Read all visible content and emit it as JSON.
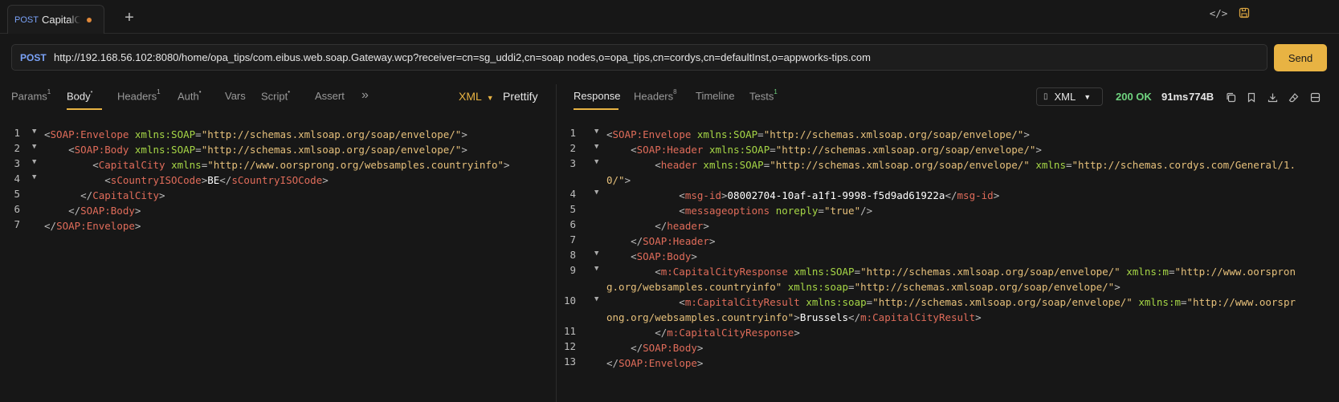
{
  "tab": {
    "method": "POST",
    "name": "CapitalCity",
    "new_tab_symbol": "+"
  },
  "request": {
    "method": "POST",
    "url": "http://192.168.56.102:8080/home/opa_tips/com.eibus.web.soap.Gateway.wcp?receiver=cn=sg_uddi2,cn=soap nodes,o=opa_tips,cn=cordys,cn=defaultInst,o=appworks-tips.com",
    "send_label": "Send"
  },
  "left_tabs": [
    {
      "label": "Params",
      "badge": "1"
    },
    {
      "label": "Body",
      "badge": "•"
    },
    {
      "label": "Headers",
      "badge": "1"
    },
    {
      "label": "Auth",
      "badge": "•"
    },
    {
      "label": "Vars",
      "badge": ""
    },
    {
      "label": "Script",
      "badge": "•"
    },
    {
      "label": "Assert",
      "badge": ""
    },
    {
      "label": "»",
      "badge": ""
    }
  ],
  "body_format": "XML",
  "prettify_label": "Prettify",
  "right_tabs": [
    {
      "label": "Response",
      "badge": ""
    },
    {
      "label": "Headers",
      "badge": "8"
    },
    {
      "label": "Timeline",
      "badge": ""
    },
    {
      "label": "Tests",
      "badge": "1"
    }
  ],
  "response_format": "XML",
  "status": "200 OK",
  "time": "91ms",
  "size": "774B",
  "icons": {
    "code": "code-icon",
    "save": "save-icon",
    "copy": "copy-icon",
    "bookmark": "bookmark-icon",
    "download": "download-icon",
    "clear": "eraser-icon",
    "layout": "layout-icon"
  },
  "request_body_lines": [
    "<SOAP:Envelope xmlns:SOAP=\"http://schemas.xmlsoap.org/soap/envelope/\">",
    "    <SOAP:Body xmlns:SOAP=\"http://schemas.xmlsoap.org/soap/envelope/\">",
    "        <CapitalCity xmlns=\"http://www.oorsprong.org/websamples.countryinfo\">",
    "          <sCountryISOCode>BE</sCountryISOCode>",
    "      </CapitalCity>",
    "    </SOAP:Body>",
    "</SOAP:Envelope>"
  ],
  "response_body_lines": [
    "<SOAP:Envelope xmlns:SOAP=\"http://schemas.xmlsoap.org/soap/envelope/\">",
    "    <SOAP:Header xmlns:SOAP=\"http://schemas.xmlsoap.org/soap/envelope/\">",
    "        <header xmlns:SOAP=\"http://schemas.xmlsoap.org/soap/envelope/\" xmlns=\"http://schemas.cordys.com/General/1.0/\">",
    "            <msg-id>08002704-10af-a1f1-9998-f5d9ad61922a</msg-id>",
    "            <messageoptions noreply=\"true\"/>",
    "        </header>",
    "    </SOAP:Header>",
    "    <SOAP:Body>",
    "        <m:CapitalCityResponse xmlns:SOAP=\"http://schemas.xmlsoap.org/soap/envelope/\" xmlns:m=\"http://www.oorsprong.org/websamples.countryinfo\" xmlns:soap=\"http://schemas.xmlsoap.org/soap/envelope/\">",
    "            <m:CapitalCityResult xmlns:soap=\"http://schemas.xmlsoap.org/soap/envelope/\" xmlns:m=\"http://www.oorsprong.org/websamples.countryinfo\">Brussels</m:CapitalCityResult>",
    "        </m:CapitalCityResponse>",
    "    </SOAP:Body>",
    "</SOAP:Envelope>"
  ]
}
